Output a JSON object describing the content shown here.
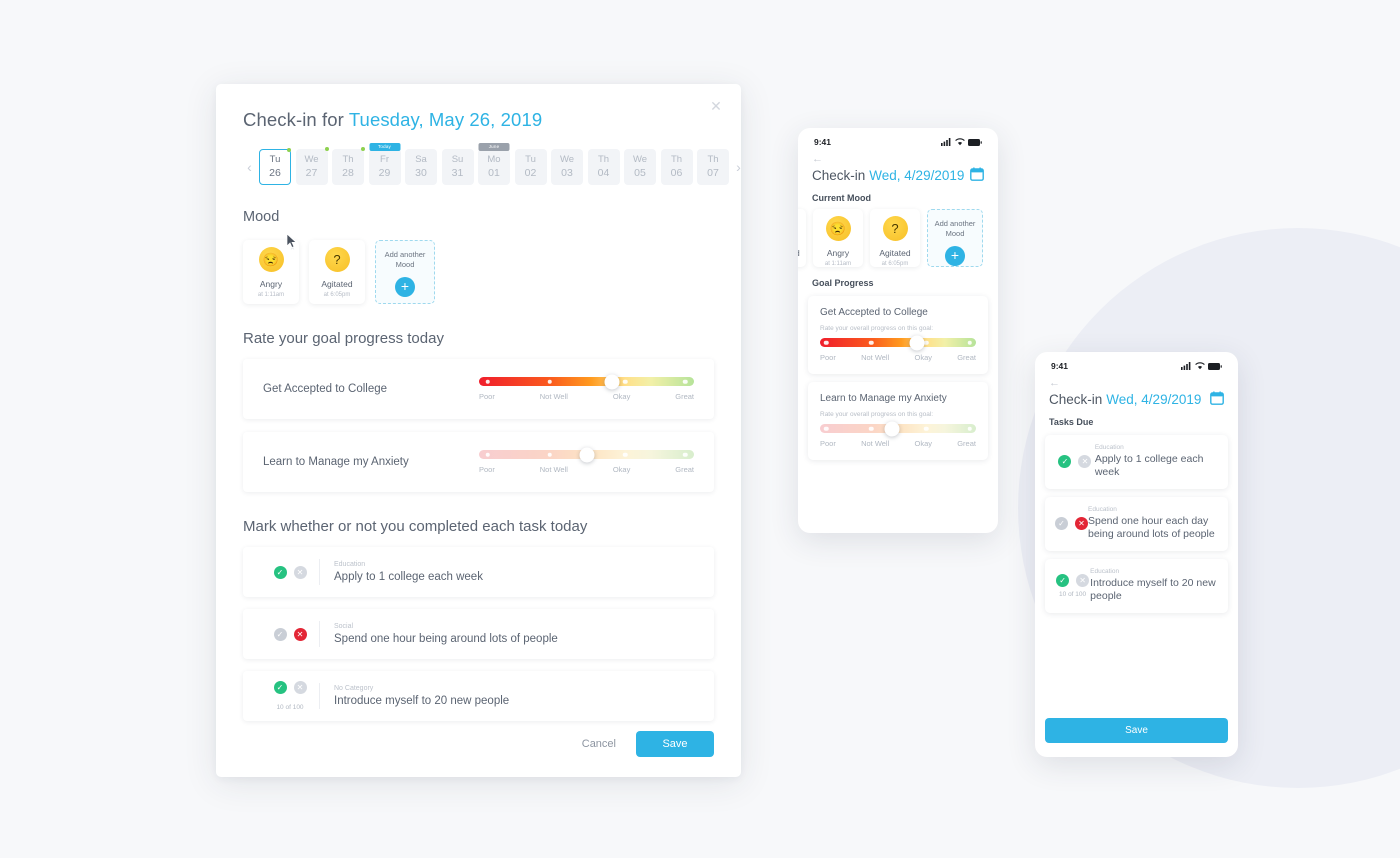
{
  "theme": {
    "accent": "#2eb3e4",
    "green": "#26c281",
    "red": "#e32636",
    "bg": "#f7f8fa",
    "circle": "#eceef5"
  },
  "modal": {
    "title_prefix": "Check-in for",
    "title_date": "Tuesday, May 26, 2019",
    "close_icon": "close-icon",
    "prev_icon": "‹",
    "next_icon": "›",
    "days": [
      {
        "dow": "Tu",
        "dd": "26",
        "selected": true,
        "dot": true,
        "chip": ""
      },
      {
        "dow": "We",
        "dd": "27",
        "selected": false,
        "dot": true,
        "chip": ""
      },
      {
        "dow": "Th",
        "dd": "28",
        "selected": false,
        "dot": true,
        "chip": ""
      },
      {
        "dow": "Fr",
        "dd": "29",
        "selected": false,
        "dot": false,
        "chip": "Today"
      },
      {
        "dow": "Sa",
        "dd": "30",
        "selected": false,
        "dot": false,
        "chip": ""
      },
      {
        "dow": "Su",
        "dd": "31",
        "selected": false,
        "dot": false,
        "chip": ""
      },
      {
        "dow": "Mo",
        "dd": "01",
        "selected": false,
        "dot": false,
        "chip": "June"
      },
      {
        "dow": "Tu",
        "dd": "02",
        "selected": false,
        "dot": false,
        "chip": ""
      },
      {
        "dow": "We",
        "dd": "03",
        "selected": false,
        "dot": false,
        "chip": ""
      },
      {
        "dow": "Th",
        "dd": "04",
        "selected": false,
        "dot": false,
        "chip": ""
      },
      {
        "dow": "We",
        "dd": "05",
        "selected": false,
        "dot": false,
        "chip": ""
      },
      {
        "dow": "Th",
        "dd": "06",
        "selected": false,
        "dot": false,
        "chip": ""
      },
      {
        "dow": "Th",
        "dd": "07",
        "selected": false,
        "dot": false,
        "chip": ""
      }
    ],
    "mood_heading": "Mood",
    "moods": [
      {
        "name": "Angry",
        "time": "at 1:11am",
        "face": "😒"
      },
      {
        "name": "Agitated",
        "time": "at 6:05pm",
        "face": "?"
      }
    ],
    "add_mood_label": "Add another\nMood",
    "add_mood_line1": "Add another",
    "add_mood_line2": "Mood",
    "plus_icon": "+",
    "goal_heading": "Rate your goal progress today",
    "goals": [
      {
        "name": "Get Accepted to College",
        "value": 62,
        "active": true
      },
      {
        "name": "Learn to Manage my Anxiety",
        "value": 50,
        "active": false
      }
    ],
    "scale_labels": [
      "Poor",
      "Not Well",
      "Okay",
      "Great"
    ],
    "task_heading": "Mark whether or not you completed each task today",
    "tasks": [
      {
        "category": "Education",
        "name": "Apply to 1 college each week",
        "done": true,
        "missed": false,
        "count": ""
      },
      {
        "category": "Social",
        "name": "Spend one hour being around lots of people",
        "done": false,
        "missed": true,
        "count": ""
      },
      {
        "category": "No Category",
        "name": "Introduce myself to 20 new people",
        "done": true,
        "missed": false,
        "count": "10 of 100"
      }
    ],
    "cancel_label": "Cancel",
    "save_label": "Save"
  },
  "phone1": {
    "time": "9:41",
    "back_icon": "←",
    "title_prefix": "Check-in",
    "title_date": "Wed, 4/29/2019",
    "calendar_icon": "calendar-icon",
    "section": "Current Mood",
    "partial_mood": "ed",
    "moods": [
      {
        "name": "Angry",
        "time": "at 1:11am",
        "face": "😒"
      },
      {
        "name": "Agitated",
        "time": "at 6:05pm",
        "face": "?"
      }
    ],
    "add_mood_line1": "Add another",
    "add_mood_line2": "Mood",
    "plus_icon": "+",
    "goal_section": "Goal Progress",
    "goal_sub": "Rate your overall progress on this goal:",
    "goals": [
      {
        "name": "Get Accepted to College",
        "value": 62,
        "active": true
      },
      {
        "name": "Learn to Manage my Anxiety",
        "value": 46,
        "active": false
      }
    ],
    "scale_labels": [
      "Poor",
      "Not Well",
      "Okay",
      "Great"
    ]
  },
  "phone2": {
    "time": "9:41",
    "back_icon": "←",
    "title_prefix": "Check-in",
    "title_date": "Wed, 4/29/2019",
    "calendar_icon": "calendar-icon",
    "section": "Tasks Due",
    "tasks": [
      {
        "category": "Education",
        "name": "Apply to 1 college each week",
        "done": true,
        "missed": false,
        "count": ""
      },
      {
        "category": "Education",
        "name": "Spend one hour each day being around lots of people",
        "done": false,
        "missed": true,
        "count": ""
      },
      {
        "category": "Education",
        "name": "Introduce myself to 20 new people",
        "done": true,
        "missed": false,
        "count": "10 of 100"
      }
    ],
    "save_label": "Save"
  }
}
